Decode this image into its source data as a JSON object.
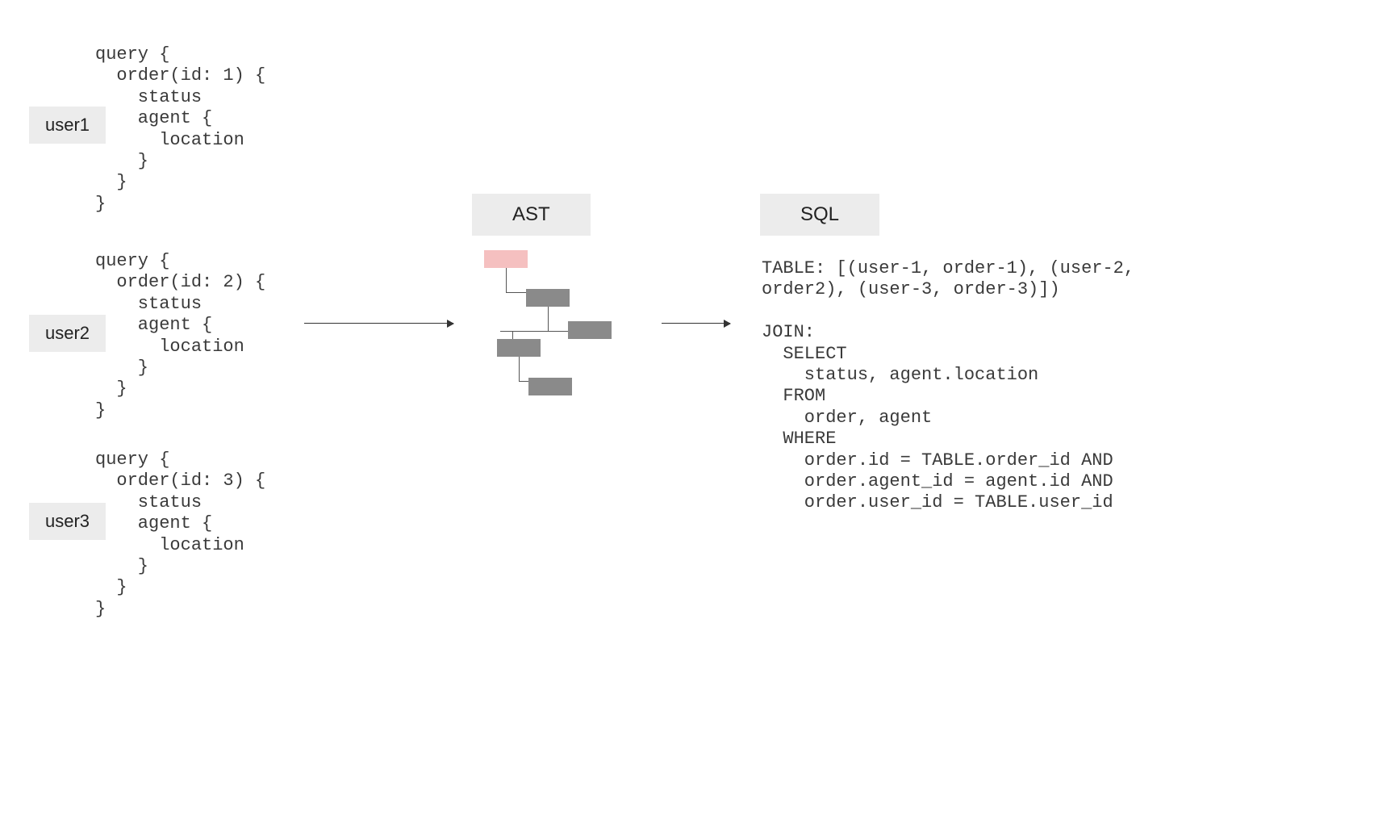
{
  "users": [
    {
      "label": "user1",
      "query": "query {\n  order(id: 1) {\n    status\n    agent {\n      location\n    }\n  }\n}"
    },
    {
      "label": "user2",
      "query": "query {\n  order(id: 2) {\n    status\n    agent {\n      location\n    }\n  }\n}"
    },
    {
      "label": "user3",
      "query": "query {\n  order(id: 3) {\n    status\n    agent {\n      location\n    }\n  }\n}"
    }
  ],
  "sections": {
    "ast": "AST",
    "sql": "SQL"
  },
  "sql": "TABLE: [(user-1, order-1), (user-2,\norder2), (user-3, order-3)])\n\nJOIN:\n  SELECT\n    status, agent.location\n  FROM\n    order, agent\n  WHERE\n    order.id = TABLE.order_id AND\n    order.agent_id = agent.id AND\n    order.user_id = TABLE.user_id"
}
